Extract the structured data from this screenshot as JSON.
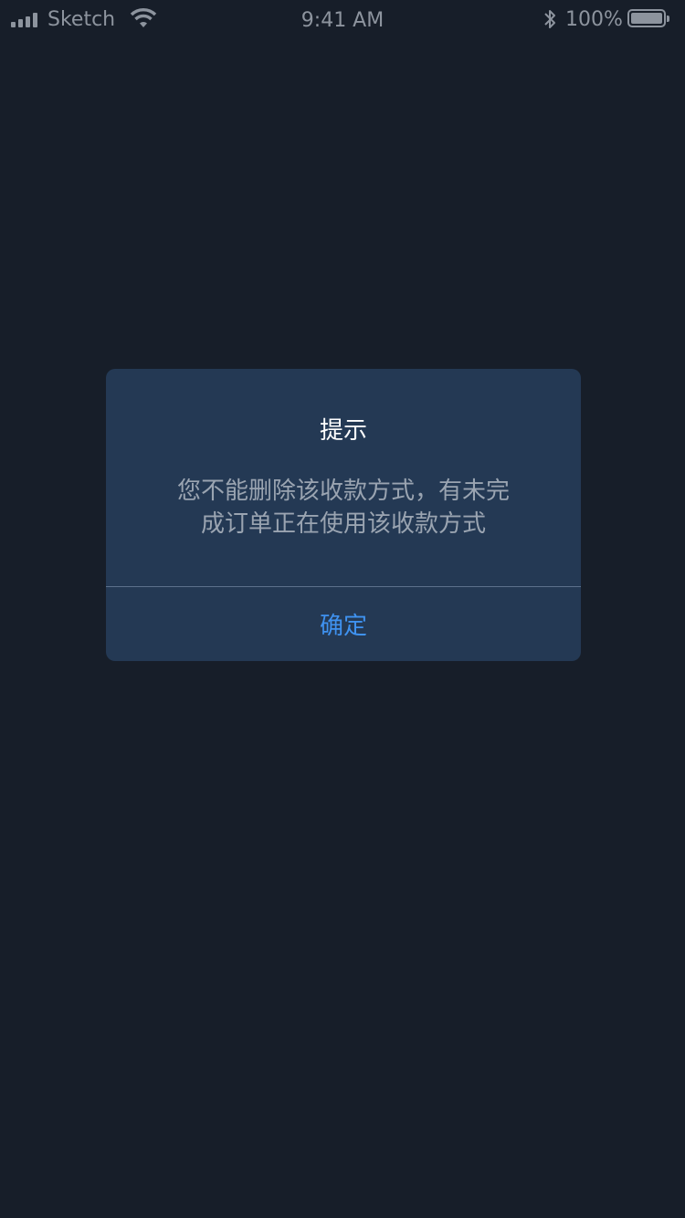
{
  "status_bar": {
    "carrier": "Sketch",
    "time": "9:41 AM",
    "battery_percent": "100%",
    "battery_level": 1.0
  },
  "dialog": {
    "title": "提示",
    "message_line1": "您不能删除该收款方式，有未完",
    "message_line2": "成订单正在使用该收款方式",
    "confirm_label": "确定"
  },
  "colors": {
    "background": "#171e29",
    "dialog_bg": "#243954",
    "accent": "#3f92f0",
    "message_text": "#9aa4b1",
    "status_text": "#8d949e"
  }
}
